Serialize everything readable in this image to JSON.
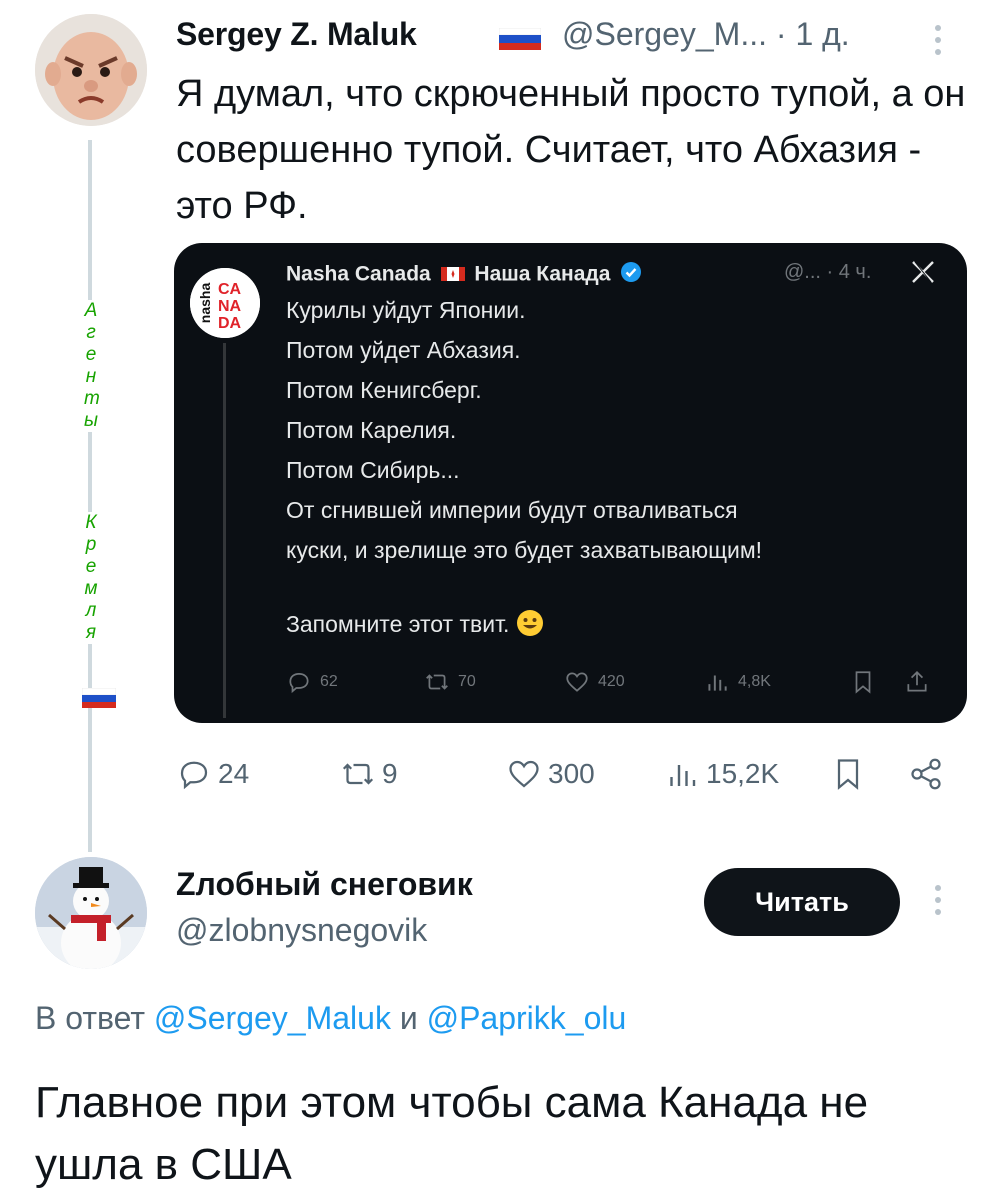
{
  "tweet1": {
    "author_name": "Sergey Z. Maluk",
    "handle": "@Sergey_M...",
    "time": "· 1 д.",
    "text": "Я думал, что скрюченный просто тупой, а он совершенно тупой. Считает, что Абхазия - это РФ.",
    "side_word_1": "Агенты",
    "side_word_2": "Кремля",
    "stats": {
      "replies": "24",
      "retweets": "9",
      "likes": "300",
      "views": "15,2K"
    }
  },
  "quoted": {
    "author_name": "Nasha Canada",
    "author_name_ru": "Наша Канада",
    "meta": "@... · 4 ч.",
    "logo_text_vertical": "nasha",
    "logo_text_1": "CA",
    "logo_text_2": "NA",
    "logo_text_3": "DA",
    "lines": [
      "Курилы уйдут Японии.",
      "Потом уйдет Абхазия.",
      "Потом Кенигсберг.",
      "Потом Карелия.",
      "Потом Сибирь...",
      "От сгнившей империи будут отваливаться",
      "куски, и зрелище это будет захватывающим!",
      "",
      "Запомните этот твит."
    ],
    "stats": {
      "replies": "62",
      "retweets": "70",
      "likes": "420",
      "views": "4,8K"
    }
  },
  "tweet2": {
    "author_name": "Zлобный снеговик",
    "handle": "@zlobnysnegovik",
    "follow_label": "Читать",
    "reply_prefix": "В ответ",
    "reply_mention_1": "@Sergey_Maluk",
    "reply_and": "и",
    "reply_mention_2": "@Paprikk_olu",
    "text": "Главное при этом чтобы сама Канада не ушла в США"
  },
  "colors": {
    "primary_text": "#0f1419",
    "secondary_text": "#536471",
    "link": "#1d9bf0",
    "card_bg": "#0b0f14",
    "verified": "#1d9bf0",
    "side_word": "#17a300"
  },
  "icons": [
    "more-icon",
    "reply-icon",
    "retweet-icon",
    "like-icon",
    "views-icon",
    "bookmark-icon",
    "share-icon",
    "x-logo-icon",
    "verified-icon",
    "smile-emoji-icon",
    "russia-flag-icon",
    "canada-flag-icon"
  ]
}
